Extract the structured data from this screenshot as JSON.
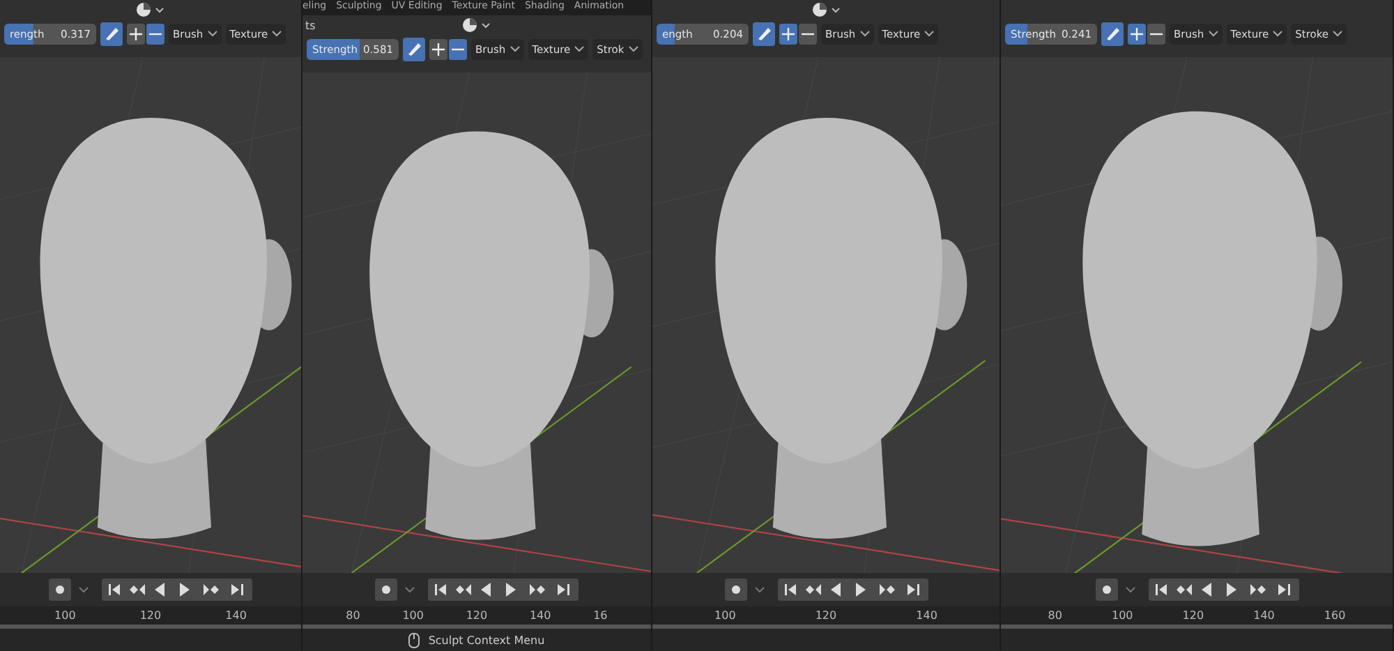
{
  "panels": [
    {
      "shading_icon": true,
      "strength": {
        "label": "rength",
        "value": "0.317",
        "level": 0.317
      },
      "direction": [
        {
          "kind": "add",
          "selected": false
        },
        {
          "kind": "subtract",
          "selected": true
        }
      ],
      "menus": [
        "Brush",
        "Texture"
      ],
      "ticks": [
        "100",
        "120",
        "140"
      ]
    },
    {
      "menu_tabs": [
        "eling",
        "Sculpting",
        "UV Editing",
        "Texture Paint",
        "Shading",
        "Animation"
      ],
      "left_label": "ts",
      "shading_icon": true,
      "strength": {
        "label": "Strength",
        "value": "0.581",
        "level": 0.581
      },
      "direction": [
        {
          "kind": "add",
          "selected": false
        },
        {
          "kind": "subtract",
          "selected": true
        }
      ],
      "menus": [
        "Brush",
        "Texture",
        "Strok"
      ],
      "ticks": [
        "80",
        "100",
        "120",
        "140",
        "16"
      ],
      "status": "Sculpt Context Menu"
    },
    {
      "shading_icon": true,
      "strength": {
        "label": "ength",
        "value": "0.204",
        "level": 0.204
      },
      "direction": [
        {
          "kind": "add",
          "selected": true
        },
        {
          "kind": "subtract",
          "selected": false
        }
      ],
      "menus": [
        "Brush",
        "Texture"
      ],
      "ticks": [
        "100",
        "120",
        "140"
      ]
    },
    {
      "shading_icon": false,
      "strength": {
        "label": "Strength",
        "value": "0.241",
        "level": 0.241
      },
      "direction": [
        {
          "kind": "add",
          "selected": true
        },
        {
          "kind": "subtract",
          "selected": false
        }
      ],
      "menus": [
        "Brush",
        "Texture",
        "Stroke"
      ],
      "ticks": [
        "80",
        "100",
        "120",
        "140",
        "160"
      ]
    }
  ]
}
